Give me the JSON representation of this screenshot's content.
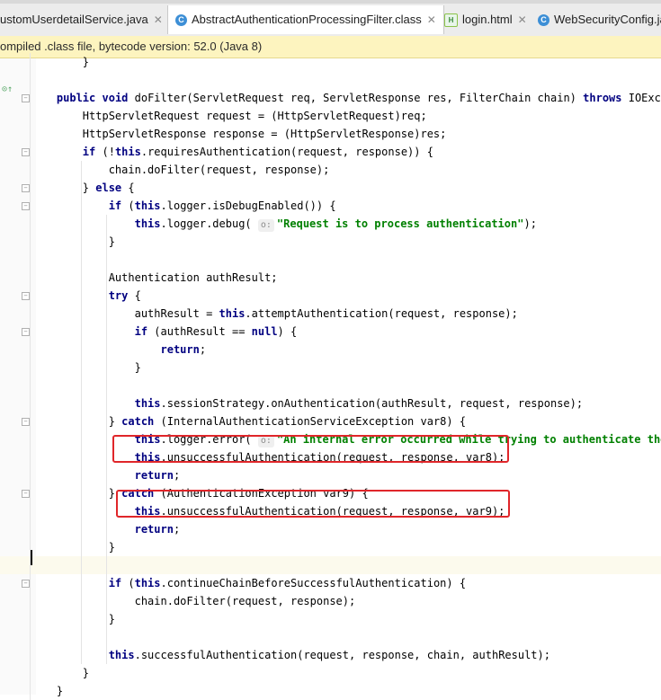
{
  "tabs": [
    {
      "label": "ustomUserdetailService.java",
      "icon": "class-icon",
      "active": false
    },
    {
      "label": "AbstractAuthenticationProcessingFilter.class",
      "icon": "class-icon",
      "active": true
    },
    {
      "label": "login.html",
      "icon": "html-file-icon",
      "active": false
    },
    {
      "label": "WebSecurityConfig.ja",
      "icon": "class-icon",
      "active": false
    }
  ],
  "notice": "ompiled .class file, bytecode version: 52.0 (Java 8)",
  "colors": {
    "keyword": "#000080",
    "string": "#008000",
    "highlight_box": "#e0262a",
    "notice_bg": "#fdf4bf"
  },
  "code_lines": [
    "        }",
    "",
    "    public void doFilter(ServletRequest req, ServletResponse res, FilterChain chain) throws IOExcept",
    "        HttpServletRequest request = (HttpServletRequest)req;",
    "        HttpServletResponse response = (HttpServletResponse)res;",
    "        if (!this.requiresAuthentication(request, response)) {",
    "            chain.doFilter(request, response);",
    "        } else {",
    "            if (this.logger.isDebugEnabled()) {",
    "                this.logger.debug( o: \"Request is to process authentication\");",
    "            }",
    "",
    "            Authentication authResult;",
    "            try {",
    "                authResult = this.attemptAuthentication(request, response);",
    "                if (authResult == null) {",
    "                    return;",
    "                }",
    "",
    "                this.sessionStrategy.onAuthentication(authResult, request, response);",
    "            } catch (InternalAuthenticationServiceException var8) {",
    "                this.logger.error( o: \"An internal error occurred while trying to authenticate the us",
    "                this.unsuccessfulAuthentication(request, response, var8);",
    "                return;",
    "            } catch (AuthenticationException var9) {",
    "                this.unsuccessfulAuthentication(request, response, var9);",
    "                return;",
    "            }",
    "",
    "            if (this.continueChainBeforeSuccessfulAuthentication) {",
    "                chain.doFilter(request, response);",
    "            }",
    "",
    "            this.successfulAuthentication(request, response, chain, authResult);",
    "        }",
    "    }"
  ]
}
